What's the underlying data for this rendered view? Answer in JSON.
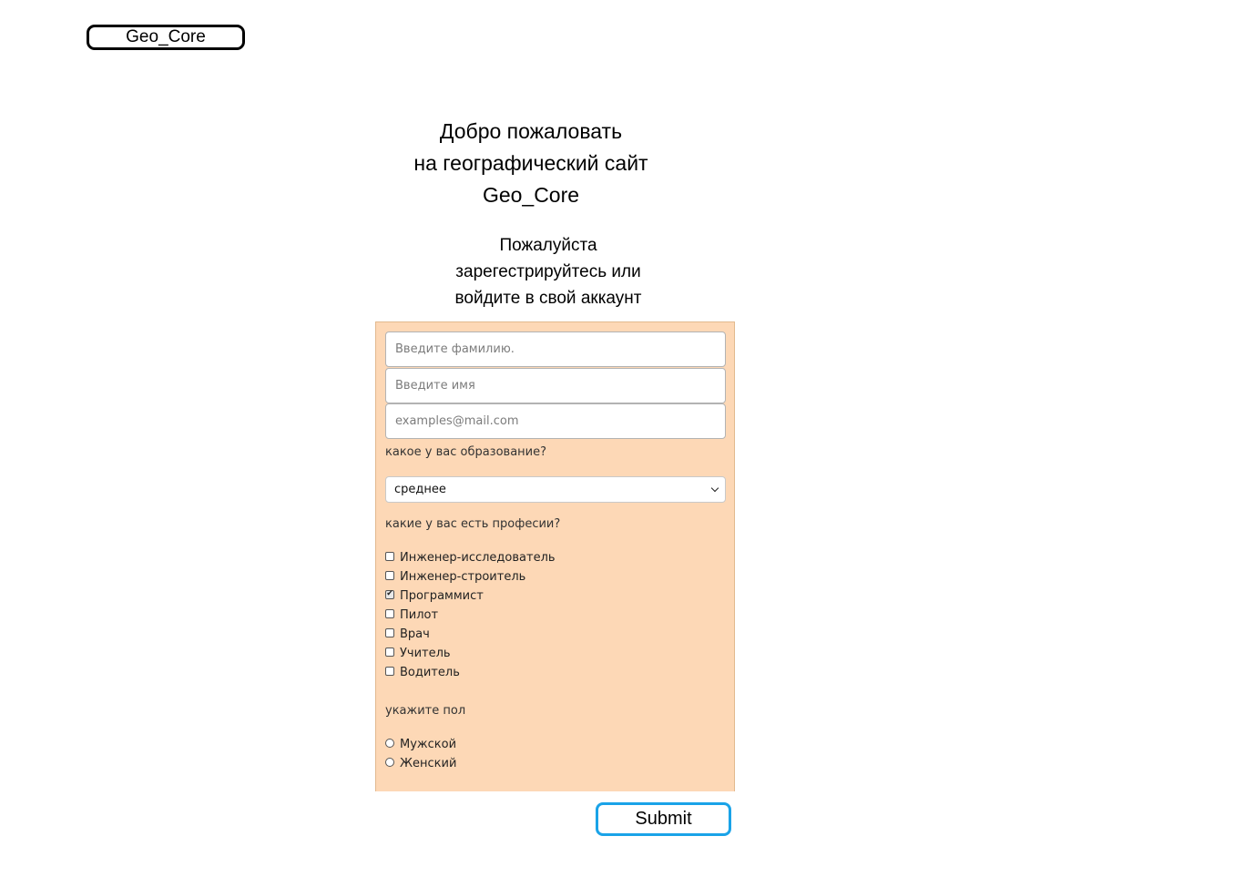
{
  "logo": {
    "text": "Geo_Core"
  },
  "welcome": {
    "lines": [
      "Добро пожаловать",
      "на географический сайт",
      "Geo_Core"
    ]
  },
  "subtitle": {
    "lines": [
      "Пожалуйста",
      "зарегестрируйтесь или",
      "войдите в свой аккаунт"
    ]
  },
  "form": {
    "panel_color": "#fdd8b6",
    "surname": {
      "placeholder": "Введите фамилию.",
      "value": ""
    },
    "name": {
      "placeholder": "Введите имя",
      "value": ""
    },
    "email": {
      "placeholder": "examples@mail.com",
      "value": ""
    },
    "education": {
      "label": "какое у вас образование?",
      "selected": "среднее"
    },
    "professions": {
      "label": "какие у вас есть професии?",
      "options": [
        {
          "label": "Инженер-исследователь",
          "checked": false
        },
        {
          "label": "Инженер-строитель",
          "checked": false
        },
        {
          "label": "Программист",
          "checked": true
        },
        {
          "label": "Пилот",
          "checked": false
        },
        {
          "label": "Врач",
          "checked": false
        },
        {
          "label": "Учитель",
          "checked": false
        },
        {
          "label": "Водитель",
          "checked": false
        }
      ]
    },
    "gender": {
      "label": "укажите пол",
      "options": [
        {
          "label": "Мужской",
          "checked": false
        },
        {
          "label": "Женский",
          "checked": false
        }
      ]
    }
  },
  "submit": {
    "label": "Submit",
    "border_color": "#1aa3e8"
  }
}
